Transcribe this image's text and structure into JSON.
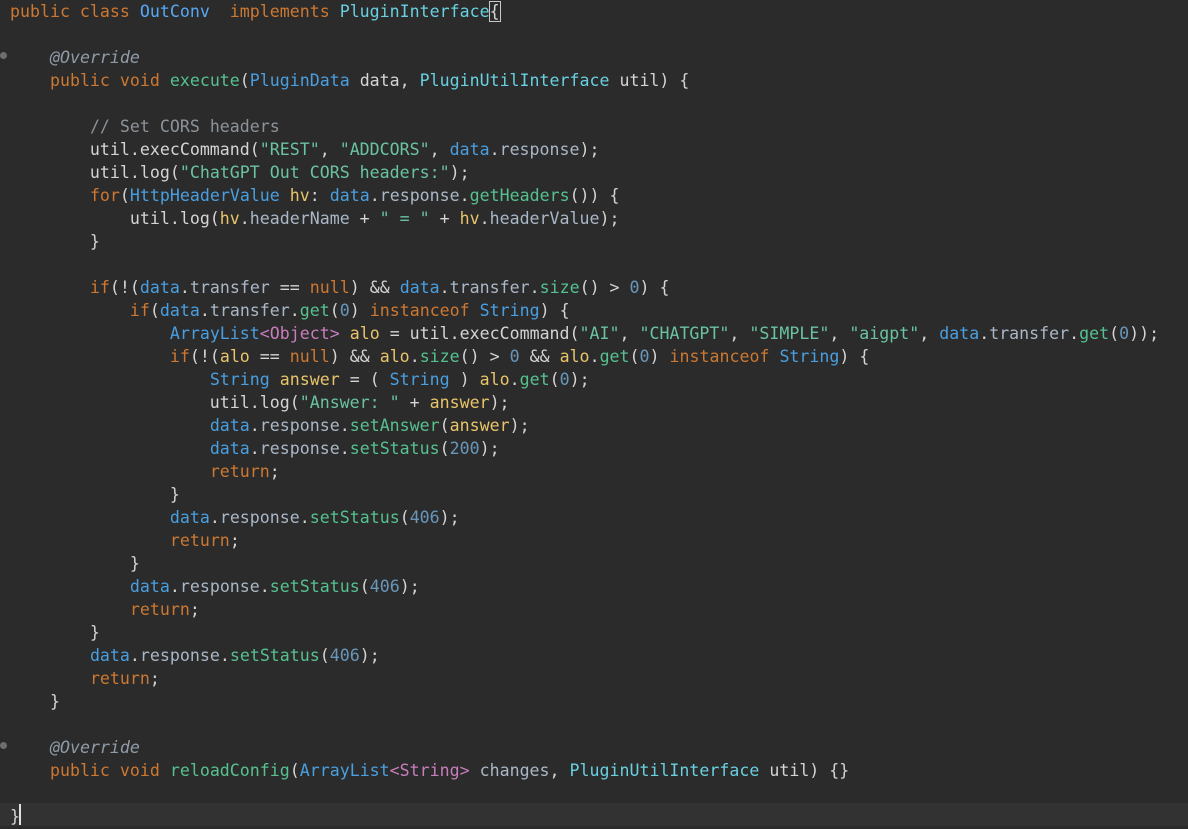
{
  "editor": {
    "lines": [
      [
        [
          "kw",
          "public class "
        ],
        [
          "class",
          "OutConv"
        ],
        [
          "plain",
          "  "
        ],
        [
          "kw",
          "implements "
        ],
        [
          "iface",
          "PluginInterface"
        ],
        [
          "brace",
          "{"
        ]
      ],
      [],
      [
        [
          "plain",
          "    "
        ],
        [
          "ann",
          "@Override"
        ]
      ],
      [
        [
          "plain",
          "    "
        ],
        [
          "kw",
          "public void "
        ],
        [
          "fn",
          "execute"
        ],
        [
          "plain",
          "("
        ],
        [
          "type",
          "PluginData"
        ],
        [
          "plain",
          " data, "
        ],
        [
          "iface",
          "PluginUtilInterface"
        ],
        [
          "plain",
          " util) {"
        ]
      ],
      [],
      [
        [
          "plain",
          "        "
        ],
        [
          "cmt",
          "// Set CORS headers"
        ]
      ],
      [
        [
          "plain",
          "        util."
        ],
        [
          "plain",
          "execCommand("
        ],
        [
          "str",
          "\"REST\""
        ],
        [
          "plain",
          ", "
        ],
        [
          "str",
          "\"ADDCORS\""
        ],
        [
          "plain",
          ", "
        ],
        [
          "type",
          "data"
        ],
        [
          "plain",
          "."
        ],
        [
          "field",
          "response"
        ],
        [
          "plain",
          ");"
        ]
      ],
      [
        [
          "plain",
          "        util.log("
        ],
        [
          "str",
          "\"ChatGPT Out CORS headers:\""
        ],
        [
          "plain",
          ");"
        ]
      ],
      [
        [
          "plain",
          "        "
        ],
        [
          "kw",
          "for"
        ],
        [
          "plain",
          "("
        ],
        [
          "type",
          "HttpHeaderValue"
        ],
        [
          "plain",
          " "
        ],
        [
          "var",
          "hv"
        ],
        [
          "plain",
          ": "
        ],
        [
          "type",
          "data"
        ],
        [
          "plain",
          "."
        ],
        [
          "field",
          "response"
        ],
        [
          "plain",
          "."
        ],
        [
          "fn",
          "getHeaders"
        ],
        [
          "plain",
          "()) {"
        ]
      ],
      [
        [
          "plain",
          "            util.log("
        ],
        [
          "var",
          "hv"
        ],
        [
          "plain",
          "."
        ],
        [
          "field",
          "headerName"
        ],
        [
          "plain",
          " + "
        ],
        [
          "str",
          "\" = \""
        ],
        [
          "plain",
          " + "
        ],
        [
          "var",
          "hv"
        ],
        [
          "plain",
          "."
        ],
        [
          "field",
          "headerValue"
        ],
        [
          "plain",
          ");"
        ]
      ],
      [
        [
          "plain",
          "        }"
        ]
      ],
      [],
      [
        [
          "plain",
          "        "
        ],
        [
          "kw",
          "if"
        ],
        [
          "plain",
          "(!("
        ],
        [
          "type",
          "data"
        ],
        [
          "plain",
          "."
        ],
        [
          "field",
          "transfer"
        ],
        [
          "plain",
          " == "
        ],
        [
          "kw",
          "null"
        ],
        [
          "plain",
          ") && "
        ],
        [
          "type",
          "data"
        ],
        [
          "plain",
          "."
        ],
        [
          "field",
          "transfer"
        ],
        [
          "plain",
          "."
        ],
        [
          "fn",
          "size"
        ],
        [
          "plain",
          "() > "
        ],
        [
          "num",
          "0"
        ],
        [
          "plain",
          ") {"
        ]
      ],
      [
        [
          "plain",
          "            "
        ],
        [
          "kw",
          "if"
        ],
        [
          "plain",
          "("
        ],
        [
          "type",
          "data"
        ],
        [
          "plain",
          "."
        ],
        [
          "field",
          "transfer"
        ],
        [
          "plain",
          "."
        ],
        [
          "fn",
          "get"
        ],
        [
          "plain",
          "("
        ],
        [
          "num",
          "0"
        ],
        [
          "plain",
          ") "
        ],
        [
          "kw",
          "instanceof "
        ],
        [
          "type",
          "String"
        ],
        [
          "plain",
          ") {"
        ]
      ],
      [
        [
          "plain",
          "                "
        ],
        [
          "type",
          "ArrayList"
        ],
        [
          "gen",
          "<Object>"
        ],
        [
          "plain",
          " "
        ],
        [
          "var",
          "alo"
        ],
        [
          "plain",
          " = util."
        ],
        [
          "plain",
          "execCommand("
        ],
        [
          "str",
          "\"AI\""
        ],
        [
          "plain",
          ", "
        ],
        [
          "str",
          "\"CHATGPT\""
        ],
        [
          "plain",
          ", "
        ],
        [
          "str",
          "\"SIMPLE\""
        ],
        [
          "plain",
          ", "
        ],
        [
          "str",
          "\"aigpt\""
        ],
        [
          "plain",
          ", "
        ],
        [
          "type",
          "data"
        ],
        [
          "plain",
          "."
        ],
        [
          "field",
          "transfer"
        ],
        [
          "plain",
          "."
        ],
        [
          "fn",
          "get"
        ],
        [
          "plain",
          "("
        ],
        [
          "num",
          "0"
        ],
        [
          "plain",
          "));"
        ]
      ],
      [
        [
          "plain",
          "                "
        ],
        [
          "kw",
          "if"
        ],
        [
          "plain",
          "(!("
        ],
        [
          "var",
          "alo"
        ],
        [
          "plain",
          " == "
        ],
        [
          "kw",
          "null"
        ],
        [
          "plain",
          ") && "
        ],
        [
          "var",
          "alo"
        ],
        [
          "plain",
          "."
        ],
        [
          "fn",
          "size"
        ],
        [
          "plain",
          "() > "
        ],
        [
          "num",
          "0"
        ],
        [
          "plain",
          " && "
        ],
        [
          "var",
          "alo"
        ],
        [
          "plain",
          "."
        ],
        [
          "fn",
          "get"
        ],
        [
          "plain",
          "("
        ],
        [
          "num",
          "0"
        ],
        [
          "plain",
          ") "
        ],
        [
          "kw",
          "instanceof "
        ],
        [
          "type",
          "String"
        ],
        [
          "plain",
          ") {"
        ]
      ],
      [
        [
          "plain",
          "                    "
        ],
        [
          "type",
          "String"
        ],
        [
          "plain",
          " "
        ],
        [
          "var",
          "answer"
        ],
        [
          "plain",
          " = ( "
        ],
        [
          "type",
          "String"
        ],
        [
          "plain",
          " ) "
        ],
        [
          "var",
          "alo"
        ],
        [
          "plain",
          "."
        ],
        [
          "fn",
          "get"
        ],
        [
          "plain",
          "("
        ],
        [
          "num",
          "0"
        ],
        [
          "plain",
          ");"
        ]
      ],
      [
        [
          "plain",
          "                    util.log("
        ],
        [
          "str",
          "\"Answer: \""
        ],
        [
          "plain",
          " + "
        ],
        [
          "var",
          "answer"
        ],
        [
          "plain",
          ");"
        ]
      ],
      [
        [
          "plain",
          "                    "
        ],
        [
          "type",
          "data"
        ],
        [
          "plain",
          "."
        ],
        [
          "field",
          "response"
        ],
        [
          "plain",
          "."
        ],
        [
          "fn",
          "setAnswer"
        ],
        [
          "plain",
          "("
        ],
        [
          "var",
          "answer"
        ],
        [
          "plain",
          ");"
        ]
      ],
      [
        [
          "plain",
          "                    "
        ],
        [
          "type",
          "data"
        ],
        [
          "plain",
          "."
        ],
        [
          "field",
          "response"
        ],
        [
          "plain",
          "."
        ],
        [
          "fn",
          "setStatus"
        ],
        [
          "plain",
          "("
        ],
        [
          "num",
          "200"
        ],
        [
          "plain",
          ");"
        ]
      ],
      [
        [
          "plain",
          "                    "
        ],
        [
          "kw",
          "return"
        ],
        [
          "plain",
          ";"
        ]
      ],
      [
        [
          "plain",
          "                }"
        ]
      ],
      [
        [
          "plain",
          "                "
        ],
        [
          "type",
          "data"
        ],
        [
          "plain",
          "."
        ],
        [
          "field",
          "response"
        ],
        [
          "plain",
          "."
        ],
        [
          "fn",
          "setStatus"
        ],
        [
          "plain",
          "("
        ],
        [
          "num",
          "406"
        ],
        [
          "plain",
          ");"
        ]
      ],
      [
        [
          "plain",
          "                "
        ],
        [
          "kw",
          "return"
        ],
        [
          "plain",
          ";"
        ]
      ],
      [
        [
          "plain",
          "            }"
        ]
      ],
      [
        [
          "plain",
          "            "
        ],
        [
          "type",
          "data"
        ],
        [
          "plain",
          "."
        ],
        [
          "field",
          "response"
        ],
        [
          "plain",
          "."
        ],
        [
          "fn",
          "setStatus"
        ],
        [
          "plain",
          "("
        ],
        [
          "num",
          "406"
        ],
        [
          "plain",
          ");"
        ]
      ],
      [
        [
          "plain",
          "            "
        ],
        [
          "kw",
          "return"
        ],
        [
          "plain",
          ";"
        ]
      ],
      [
        [
          "plain",
          "        }"
        ]
      ],
      [
        [
          "plain",
          "        "
        ],
        [
          "type",
          "data"
        ],
        [
          "plain",
          "."
        ],
        [
          "field",
          "response"
        ],
        [
          "plain",
          "."
        ],
        [
          "fn",
          "setStatus"
        ],
        [
          "plain",
          "("
        ],
        [
          "num",
          "406"
        ],
        [
          "plain",
          ");"
        ]
      ],
      [
        [
          "plain",
          "        "
        ],
        [
          "kw",
          "return"
        ],
        [
          "plain",
          ";"
        ]
      ],
      [
        [
          "plain",
          "    }"
        ]
      ],
      [],
      [
        [
          "plain",
          "    "
        ],
        [
          "ann",
          "@Override"
        ]
      ],
      [
        [
          "plain",
          "    "
        ],
        [
          "kw",
          "public void "
        ],
        [
          "fn",
          "reloadConfig"
        ],
        [
          "plain",
          "("
        ],
        [
          "type",
          "ArrayList"
        ],
        [
          "gen",
          "<String>"
        ],
        [
          "plain",
          " "
        ],
        [
          "field",
          "changes"
        ],
        [
          "plain",
          ", "
        ],
        [
          "iface",
          "PluginUtilInterface"
        ],
        [
          "plain",
          " util) {}"
        ]
      ],
      [],
      [
        [
          "plain",
          "}"
        ]
      ]
    ]
  }
}
